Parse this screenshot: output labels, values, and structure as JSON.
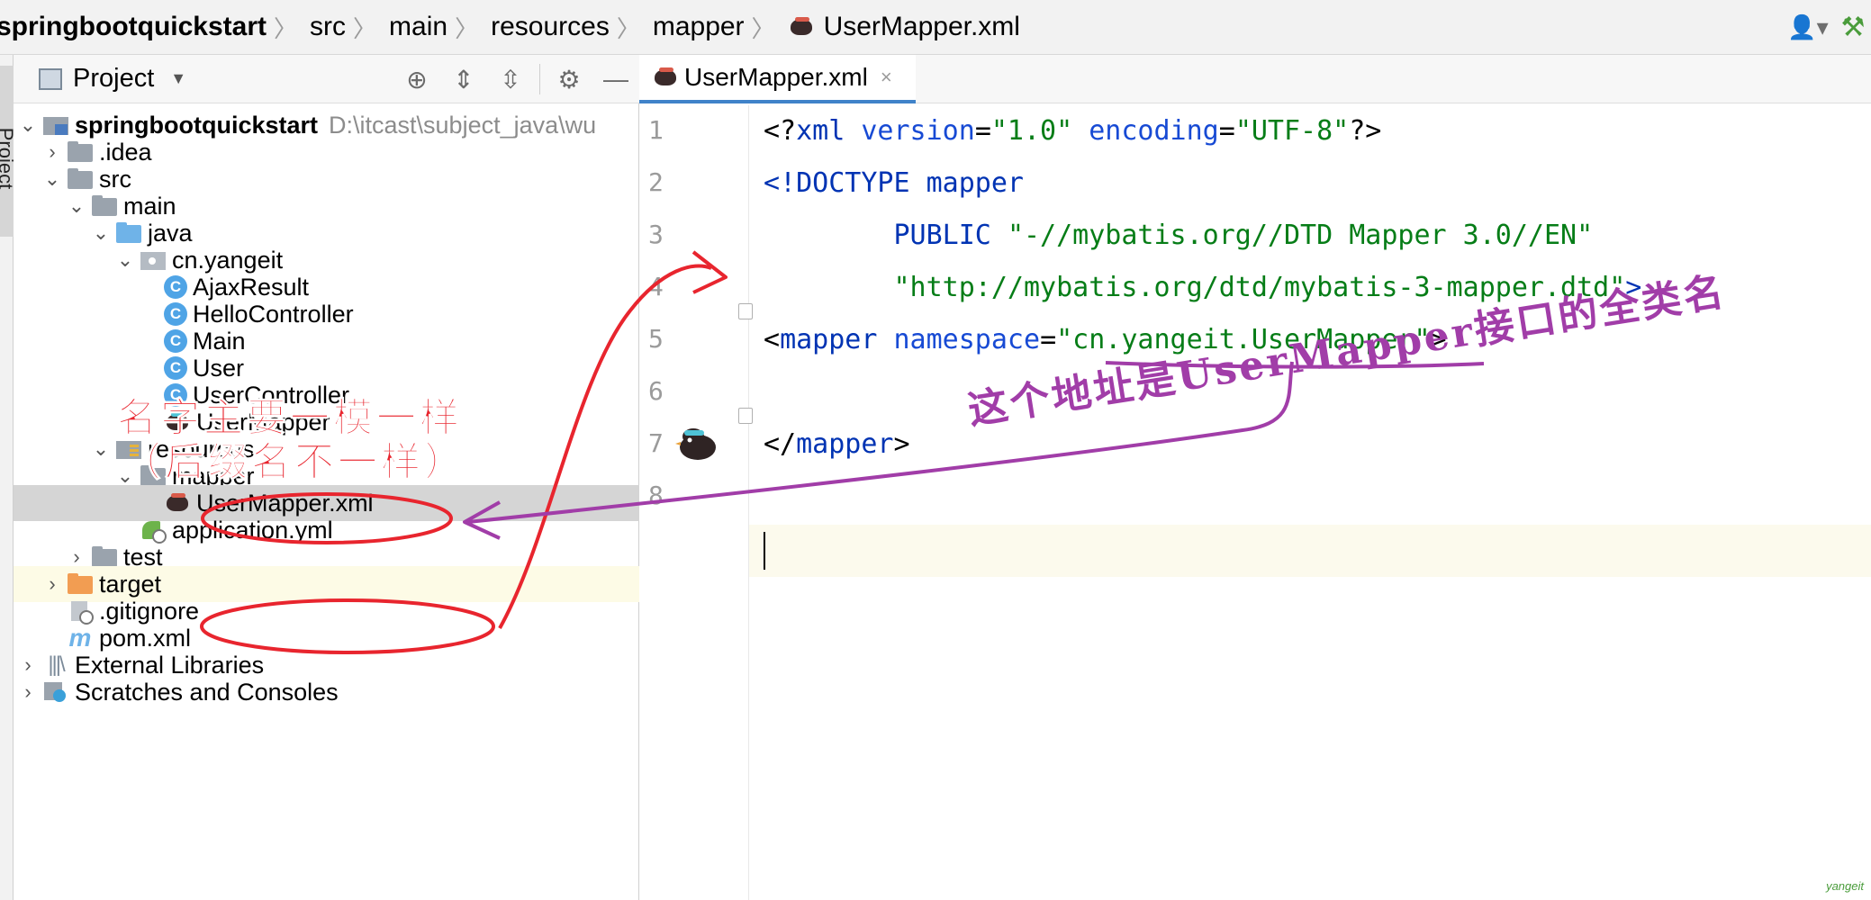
{
  "breadcrumb": {
    "items": [
      "springbootquickstart",
      "src",
      "main",
      "resources",
      "mapper",
      "UserMapper.xml"
    ],
    "separator": "〉"
  },
  "side_strip": {
    "label": "Project"
  },
  "project_panel": {
    "title": "Project",
    "tools": [
      "locate-icon",
      "expand-all-icon",
      "collapse-all-icon",
      "settings-icon",
      "minimize-icon"
    ],
    "tree": [
      {
        "label": "springbootquickstart",
        "hint": "D:\\itcast\\subject_java\\wu",
        "icon": "module",
        "arrow": "expanded",
        "depth": 0
      },
      {
        "label": ".idea",
        "icon": "folder",
        "arrow": "collapsed",
        "depth": 1
      },
      {
        "label": "src",
        "icon": "folder",
        "arrow": "expanded",
        "depth": 1
      },
      {
        "label": "main",
        "icon": "folder",
        "arrow": "expanded",
        "depth": 2
      },
      {
        "label": "java",
        "icon": "folder-blue",
        "arrow": "expanded",
        "depth": 3
      },
      {
        "label": "cn.yangeit",
        "icon": "package",
        "arrow": "expanded",
        "depth": 4
      },
      {
        "label": "AjaxResult",
        "icon": "class",
        "depth": 5
      },
      {
        "label": "HelloController",
        "icon": "class",
        "depth": 5
      },
      {
        "label": "Main",
        "icon": "class",
        "depth": 5
      },
      {
        "label": "User",
        "icon": "class",
        "depth": 5
      },
      {
        "label": "UserController",
        "icon": "class",
        "depth": 5
      },
      {
        "label": "UserMapper",
        "icon": "mybatis",
        "depth": 5
      },
      {
        "label": "resources",
        "icon": "resources",
        "arrow": "expanded",
        "depth": 3
      },
      {
        "label": "mapper",
        "icon": "folder",
        "arrow": "expanded",
        "depth": 4
      },
      {
        "label": "UserMapper.xml",
        "icon": "mybatis-xml",
        "depth": 5,
        "selected": true
      },
      {
        "label": "application.yml",
        "icon": "yml",
        "depth": 4
      },
      {
        "label": "test",
        "icon": "folder",
        "arrow": "collapsed",
        "depth": 2
      },
      {
        "label": "target",
        "icon": "folder-orange",
        "arrow": "collapsed",
        "depth": 1,
        "highlight": true
      },
      {
        "label": ".gitignore",
        "icon": "gitignore",
        "depth": 1
      },
      {
        "label": "pom.xml",
        "icon": "maven",
        "depth": 1
      },
      {
        "label": "External Libraries",
        "icon": "libraries",
        "arrow": "collapsed",
        "depth": 0
      },
      {
        "label": "Scratches and Consoles",
        "icon": "scratches",
        "arrow": "collapsed",
        "depth": 0
      }
    ]
  },
  "editor": {
    "tab": {
      "label": "UserMapper.xml",
      "close": "×"
    },
    "line_numbers": [
      "1",
      "2",
      "3",
      "4",
      "5",
      "6",
      "7",
      "8"
    ],
    "lines": [
      [
        {
          "t": "<?",
          "c": "punct"
        },
        {
          "t": "xml ",
          "c": "tag"
        },
        {
          "t": "version",
          "c": "attr"
        },
        {
          "t": "=",
          "c": "punct"
        },
        {
          "t": "\"1.0\" ",
          "c": "str"
        },
        {
          "t": "encoding",
          "c": "attr"
        },
        {
          "t": "=",
          "c": "punct"
        },
        {
          "t": "\"UTF-8\"",
          "c": "str"
        },
        {
          "t": "?>",
          "c": "punct"
        }
      ],
      [
        {
          "t": "<!DOCTYPE ",
          "c": "tag"
        },
        {
          "t": "mapper",
          "c": "tag"
        }
      ],
      [
        {
          "t": "        PUBLIC ",
          "c": "tag"
        },
        {
          "t": "\"-//mybatis.org//DTD Mapper 3.0//EN\"",
          "c": "str"
        }
      ],
      [
        {
          "t": "        \"http://mybatis.org/dtd/mybatis-3-mapper.dtd\"",
          "c": "str"
        },
        {
          "t": ">",
          "c": "tag"
        }
      ],
      [
        {
          "t": "<",
          "c": "punct"
        },
        {
          "t": "mapper ",
          "c": "tag"
        },
        {
          "t": "namespace",
          "c": "attr"
        },
        {
          "t": "=",
          "c": "punct"
        },
        {
          "t": "\"cn.yangeit.UserMapper\"",
          "c": "str"
        },
        {
          "t": ">",
          "c": "punct"
        }
      ],
      [],
      [
        {
          "t": "</",
          "c": "punct"
        },
        {
          "t": "mapper",
          "c": "tag"
        },
        {
          "t": ">",
          "c": "punct"
        }
      ],
      []
    ],
    "current_line": 8
  },
  "annotations": {
    "red_note_line1": "名字主要一模一样",
    "red_note_line2": "（后缀名不一样）",
    "purple_note": "这个地址是UserMapper接口的全类名",
    "watermark": "yangeit"
  },
  "colors": {
    "selection_bg": "#d5d5d5",
    "highlight_row_bg": "#fdfbe6",
    "tab_underline": "#4083c9",
    "xml_tag": "#0033b3",
    "xml_attr": "#174ad4",
    "xml_string": "#067d17",
    "annotation_red": "#e8252e",
    "annotation_purple": "#a13da8"
  }
}
